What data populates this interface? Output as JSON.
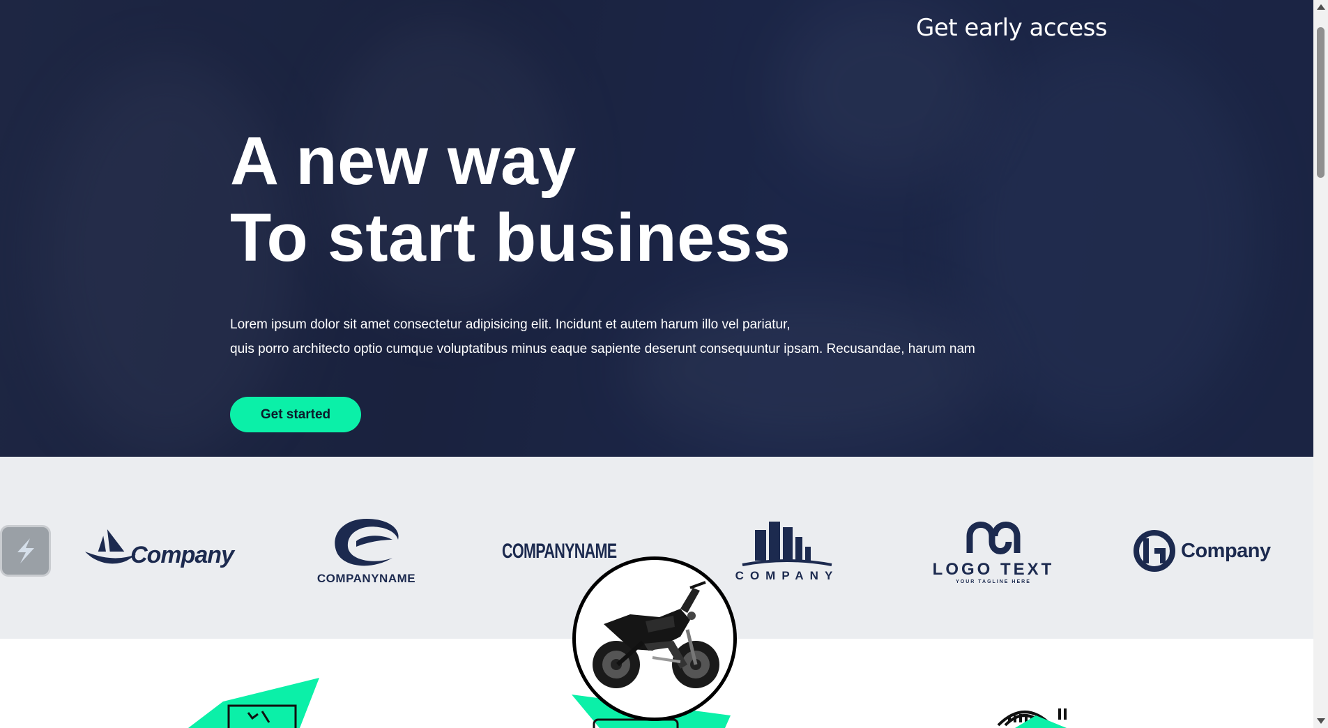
{
  "header": {
    "early_access": "Get early access"
  },
  "hero": {
    "headline_line1": "A new way",
    "headline_line2": "To start business",
    "lede_line1": "Lorem ipsum dolor sit amet consectetur adipisicing elit. Incidunt et autem harum illo vel pariatur,",
    "lede_line2": "quis porro architecto optio cumque voluptatibus minus eaque sapiente deserunt consequuntur ipsam. Recusandae, harum nam",
    "cta_label": "Get started"
  },
  "logos": {
    "company1": "Company",
    "companyname1": "COMPANYNAME",
    "companyname2": "COMPANYNAME",
    "company3": "COMPANY",
    "logotext": "LOGO TEXT",
    "logotext_tagline": "YOUR TAGLINE HERE",
    "company2": "Company"
  },
  "colors": {
    "accent": "#0bf0a8",
    "hero_bg": "#1d2644",
    "strip_bg": "#ebedf0",
    "logo_navy": "#1c2a4f"
  }
}
